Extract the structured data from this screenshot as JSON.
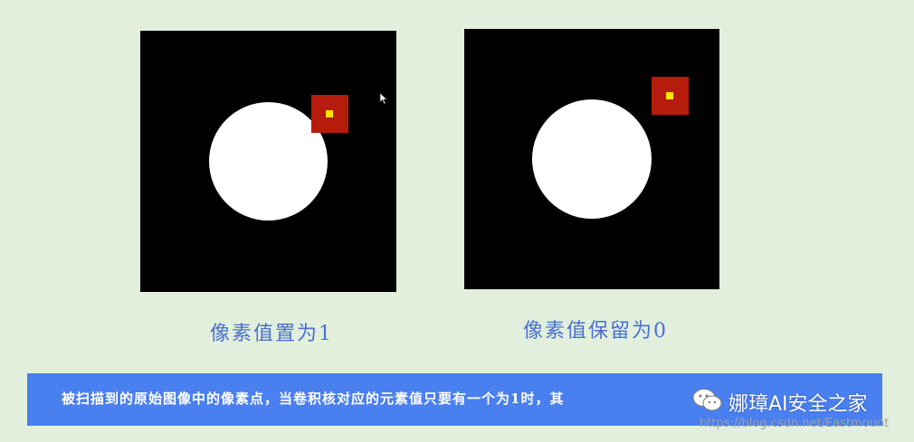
{
  "diagram": {
    "left_caption": "像素值置为1",
    "right_caption": "像素值保留为0",
    "colors": {
      "background": "#e2efdc",
      "panel": "#000000",
      "circle": "#ffffff",
      "kernel": "#b51c0c",
      "kernel_center": "#ffe600",
      "caption": "#4a6fd0",
      "banner": "#4a7ff0"
    }
  },
  "banner": {
    "text": "被扫描到的原始图像中的像素点，当卷积核对应的元素值只要有一个为1时，其"
  },
  "watermark": {
    "icon": "wechat-icon",
    "title": "娜璋AI安全之家",
    "url": "https://blog.csdn.net/Eastmount"
  }
}
